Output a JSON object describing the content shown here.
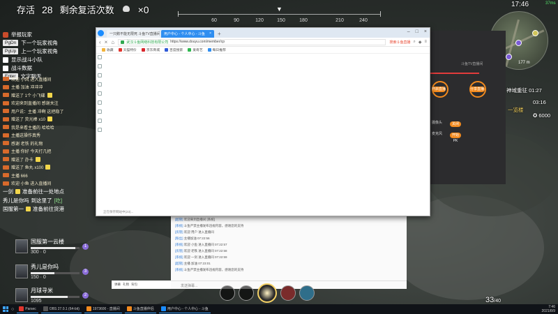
{
  "hud": {
    "alive_label": "存活",
    "alive_count": "28",
    "revive_label": "剩余复活次数",
    "revive_count": "×0"
  },
  "compass": {
    "labels": [
      "60",
      "90",
      "120",
      "150",
      "180",
      "210",
      "240"
    ]
  },
  "hotkeys": [
    {
      "label": "举报玩家"
    },
    {
      "key": "PgDn",
      "label": "下一个玩家视角"
    },
    {
      "key": "PgUp",
      "label": "上一个玩家视角"
    },
    {
      "label": "显示战斗小队"
    },
    {
      "label": "战斗数据"
    },
    {
      "key": "Enter",
      "label": "文字聊天"
    }
  ],
  "chat": [
    "欢迎 小风 进入直播间",
    "主播 加油 冲冲冲",
    "赠送了 1个 小飞碟",
    "欢迎来到直播间 感谢关注",
    "用户说：主播 冲啊 这把稳了",
    "赠送了 荧光棒 x10",
    "我是来看主播的 哈哈哈",
    "主播这操作真秀",
    "感谢 老铁 的礼物",
    "主播 你好 今天打几把",
    "赠送了 办卡",
    "赠送了 鱼丸 x100",
    "主播 666",
    "欢迎 小鱼 进入直播间"
  ],
  "chat_big": [
    {
      "name": "一剑",
      "text": "准备前往一处地点"
    },
    {
      "name": "秀儿是你吗",
      "text": "到这里了",
      "reply": "[吃]"
    },
    {
      "name": "国服第一",
      "text": "准备前往货港"
    }
  ],
  "squad": [
    {
      "name": "国服第一云楼",
      "hp": "300",
      "kills": "0",
      "level": "1",
      "health": 0.92
    },
    {
      "name": "秀儿是你吗",
      "hp": "150",
      "kills": "0",
      "level": "3",
      "health": 0.48
    },
    {
      "name": "月球寻米",
      "hp": "1095",
      "kills": "",
      "level": "2",
      "health": 0.75
    }
  ],
  "minimap": {
    "time": "17:46",
    "signal": "37ms",
    "distance": "177 m"
  },
  "hud_right": {
    "zone_label": "神域重征 01:27",
    "zone_status": "一览楼",
    "timer": "03:16",
    "currency": "6000"
  },
  "browser": {
    "tabs": [
      {
        "title": "一只鹅不能无限死 斗鱼TV直播间"
      },
      {
        "title": "用户中心 - 个人中心 - 斗鱼"
      }
    ],
    "controls": [
      "–",
      "□",
      "×"
    ],
    "security": "武汉斗鱼网络科技有限公司",
    "url": "https://www.douyu.com/member/cp",
    "search_hint": "搜索斗鱼直播",
    "bookmarks": [
      "收藏",
      "天猫特价",
      "京东商城",
      "百度搜索",
      "爱奇艺",
      "每日推荐"
    ],
    "status": "正在保存网站中(23)..."
  },
  "douyu": {
    "panel_title": "斗鱼TV直播间",
    "btn1": "开启直播",
    "btn2": "分享直播",
    "btn3": "开始PK",
    "opt1": "摄像头",
    "opt2": "麦克风",
    "btn4": "关闭",
    "msgs": [
      {
        "user": "[超管]",
        "text": "欢迎来到直播间 [系统]"
      },
      {
        "user": "[系统]",
        "text": "斗鱼严禁主播发布违规内容，感谢您的支持"
      },
      {
        "user": "[房管]",
        "text": "欢迎 用户 进入直播间"
      },
      {
        "user": "[粉丝]",
        "text": "主播加油 07:22:56"
      },
      {
        "user": "[系统]",
        "text": "欢迎 小鱼 进入直播间 07:22:57"
      },
      {
        "user": "[房管]",
        "text": "欢迎 老铁 进入直播间 07:22:58"
      },
      {
        "user": "[系统]",
        "text": "欢迎 一剑 进入直播间 07:22:59"
      },
      {
        "user": "[超管]",
        "text": "主播 加油 07:23:01"
      },
      {
        "user": "[系统]",
        "text": "斗鱼严禁主播发布违规内容，感谢您的支持"
      }
    ],
    "input_placeholder": "发送弹幕...",
    "tools": [
      "弹幕",
      "礼物",
      "背包"
    ]
  },
  "ammo": {
    "current": "33",
    "total": "/40"
  },
  "taskbar": {
    "items": [
      "Parsec",
      "OBS 27.0.1 (64-bit)",
      "1973600 - 直播间",
      "斗鱼直播伴侣",
      "用户中心 - 个人中心 - 斗鱼"
    ],
    "clock_time": "7:46",
    "clock_date": "2021/8/9"
  },
  "colors": {
    "accent": "#2f8ef0",
    "orange": "#f28a1e",
    "purple": "#7b5cd6"
  }
}
